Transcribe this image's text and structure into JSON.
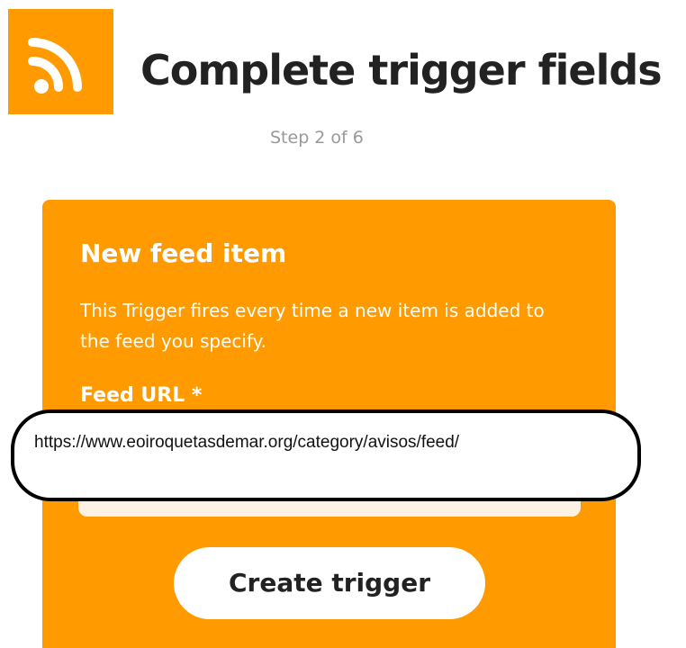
{
  "header": {
    "title": "Complete trigger fields",
    "step": "Step 2 of 6",
    "service_icon": "rss-feed-icon"
  },
  "card": {
    "title": "New feed item",
    "description": "This Trigger fires every time a new item is added to the feed you specify.",
    "field_label": "Feed URL *",
    "field_value": "https://www.eoiroquetasdemar.org/category/avisos/feed/",
    "button_label": "Create trigger"
  },
  "colors": {
    "accent": "#ff9a00",
    "title_text": "#222222",
    "step_text": "#999999"
  }
}
